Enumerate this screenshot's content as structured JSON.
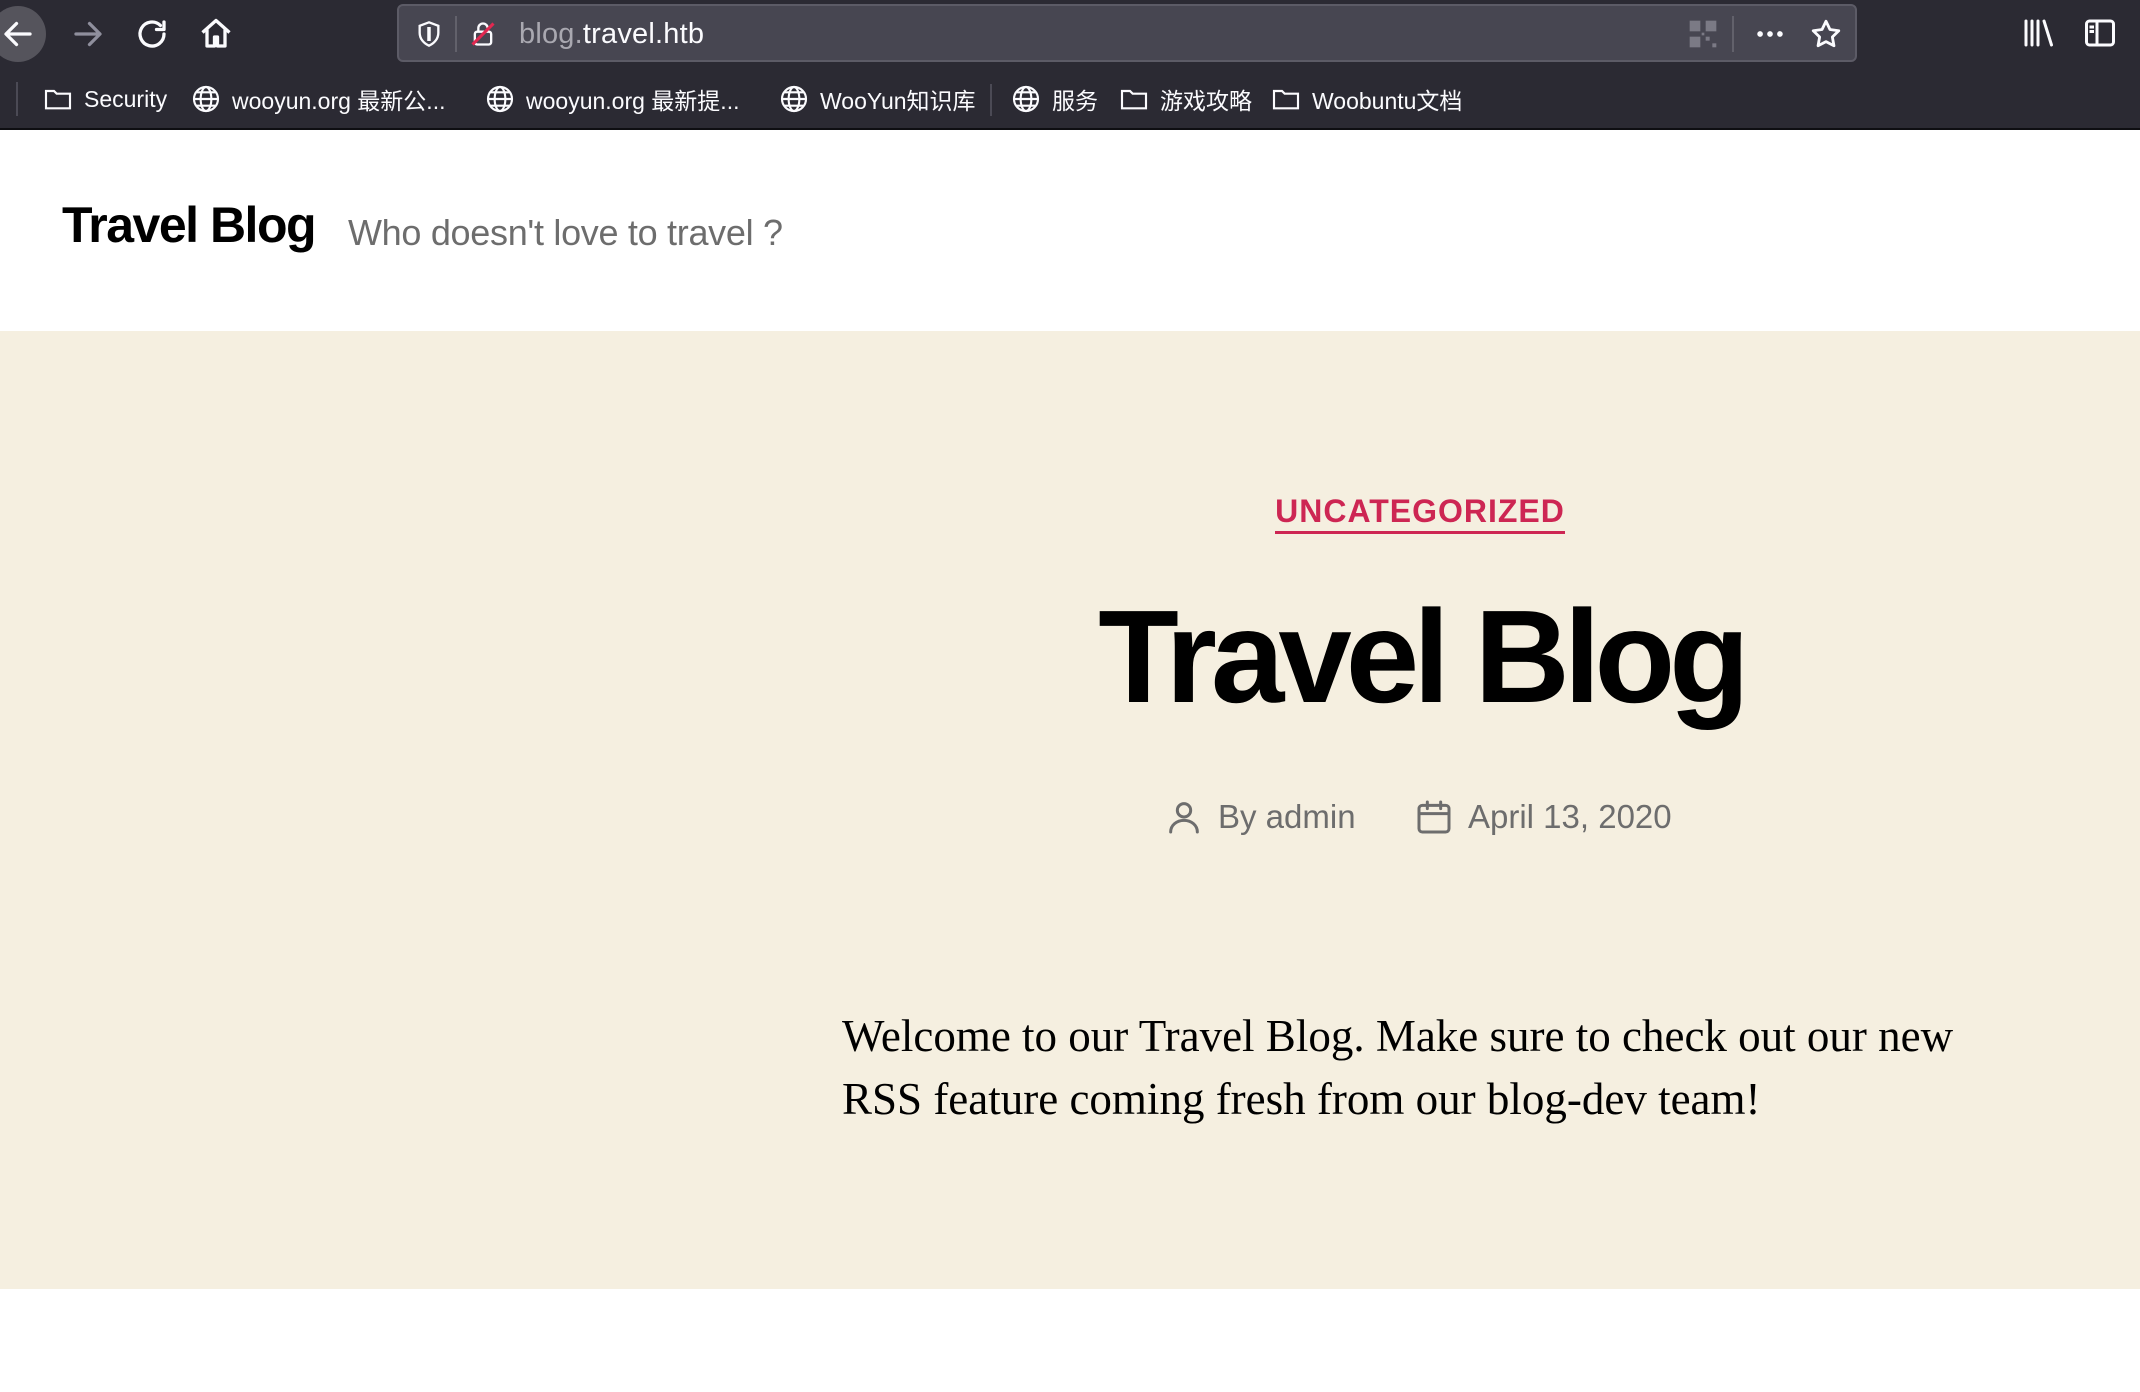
{
  "browser": {
    "url_subdomain": "blog.",
    "url_domain": "travel.htb",
    "bookmarks": [
      {
        "label": "Security",
        "icon": "folder-icon"
      },
      {
        "label": "wooyun.org 最新公...",
        "icon": "globe-icon"
      },
      {
        "label": "wooyun.org 最新提...",
        "icon": "globe-icon"
      },
      {
        "label": "WooYun知识库",
        "icon": "globe-icon"
      },
      {
        "label": "服务",
        "icon": "globe-icon"
      },
      {
        "label": "游戏攻略",
        "icon": "folder-icon"
      },
      {
        "label": "Woobuntu文档",
        "icon": "folder-icon"
      }
    ]
  },
  "site": {
    "title": "Travel Blog",
    "description": "Who doesn't love to travel ?"
  },
  "post": {
    "category": "UNCATEGORIZED",
    "title": "Travel Blog",
    "author": "By admin",
    "date": "April 13, 2020",
    "content": "Welcome to our Travel Blog. Make sure to check out our new RSS feature coming fresh from our blog-dev team!"
  },
  "colors": {
    "chrome_bg": "#2b2a33",
    "hero_bg": "#f5efe0",
    "accent": "#cd2653"
  }
}
